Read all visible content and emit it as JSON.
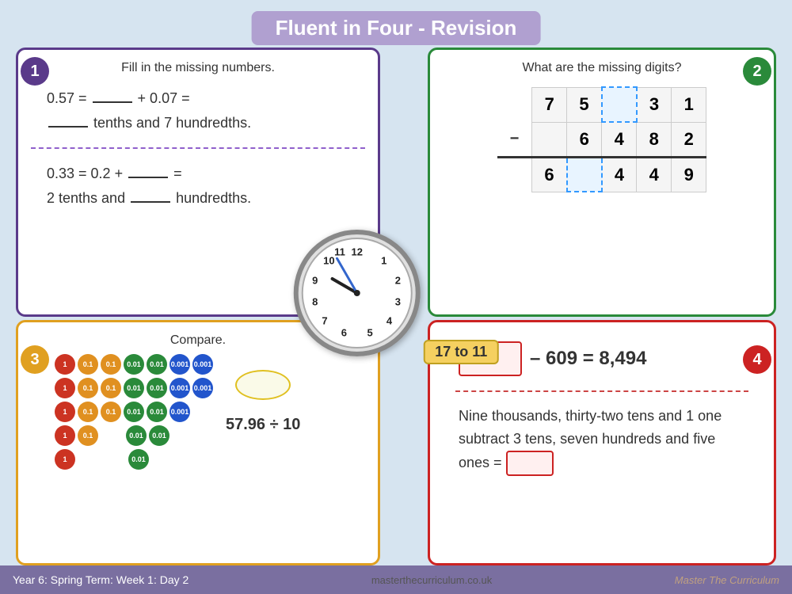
{
  "title": "Fluent in Four - Revision",
  "bottom": {
    "left": "Year 6: Spring Term: Week 1: Day  2",
    "center": "masterthecurriculum.co.uk",
    "right": "Master The Curriculum"
  },
  "q1": {
    "badge": "1",
    "instruction": "Fill in the missing numbers.",
    "line1a": "0.57 = _____ + 0.07 =",
    "line1b": "_____ tenths and 7 hundredths.",
    "line2a": "0.33 = 0.2 +  _____ =",
    "line2b": "2 tenths and _____ hundredths."
  },
  "q2": {
    "badge": "2",
    "instruction": "What are the missing digits?",
    "rows": [
      [
        "",
        "7",
        "5",
        "□",
        "3",
        "1"
      ],
      [
        "–",
        "",
        "6",
        "4",
        "8",
        "2"
      ],
      [
        "",
        "6",
        "□",
        "4",
        "4",
        "9"
      ]
    ]
  },
  "q3": {
    "badge": "3",
    "instruction": "Compare.",
    "math": "57.96 ÷ 10"
  },
  "q4": {
    "badge": "4",
    "equation": "– 609 = 8,494",
    "text": "Nine thousands, thirty-two tens and 1 one subtract 3 tens, seven hundreds and five ones ="
  },
  "clock": {
    "label": "17 to 11"
  }
}
